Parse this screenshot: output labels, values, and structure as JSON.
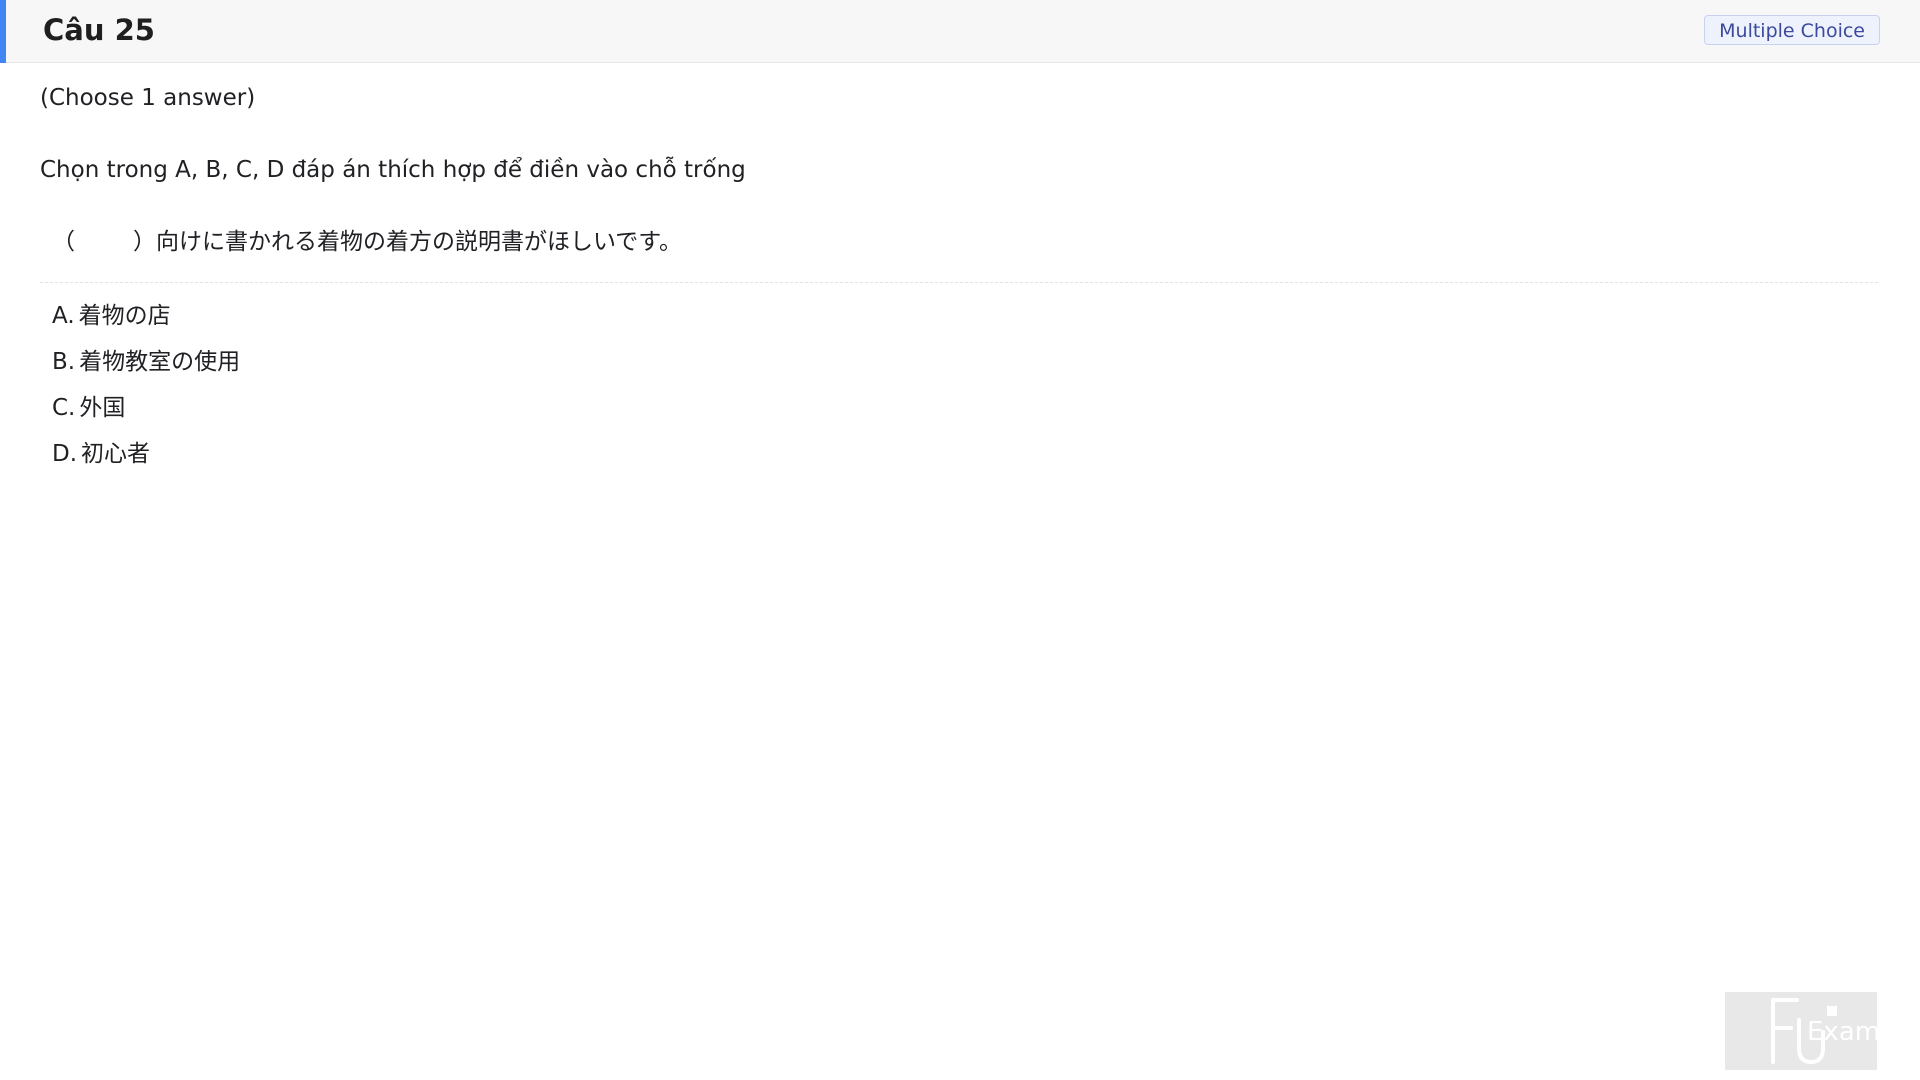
{
  "header": {
    "title": "Câu 25",
    "badge": "Multiple Choice",
    "accent_color": "#4285f4"
  },
  "question": {
    "instruction": "(Choose 1 answer)",
    "prompt": "Chọn trong A, B, C, D đáp án thích hợp để điền vào chỗ trống",
    "text_open": "（",
    "text_close": "）",
    "text_body": "向けに書かれる着物の着方の説明書がほしいです。"
  },
  "options": [
    {
      "letter": "A.",
      "text": "着物の店"
    },
    {
      "letter": "B.",
      "text": "着物教室の使用"
    },
    {
      "letter": "C.",
      "text": "外国"
    },
    {
      "letter": "D.",
      "text": "初心者"
    }
  ],
  "watermark": {
    "icon": "fu-exam-logo",
    "text": "Exam"
  }
}
